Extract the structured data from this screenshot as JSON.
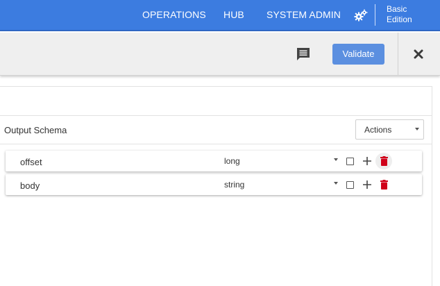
{
  "nav": {
    "links": [
      "OPERATIONS",
      "HUB",
      "SYSTEM ADMIN"
    ],
    "settings_icon": "gears-icon",
    "edition_line1": "Basic",
    "edition_line2": "Edition",
    "background": "#3c7ce0"
  },
  "toolbar": {
    "comment_icon": "comment-icon",
    "validate_label": "Validate",
    "close_icon": "close-icon"
  },
  "schema": {
    "title": "Output Schema",
    "actions_label": "Actions",
    "fields": [
      {
        "name": "offset",
        "type": "long"
      },
      {
        "name": "body",
        "type": "string"
      }
    ],
    "delete_color": "#d0021b"
  }
}
